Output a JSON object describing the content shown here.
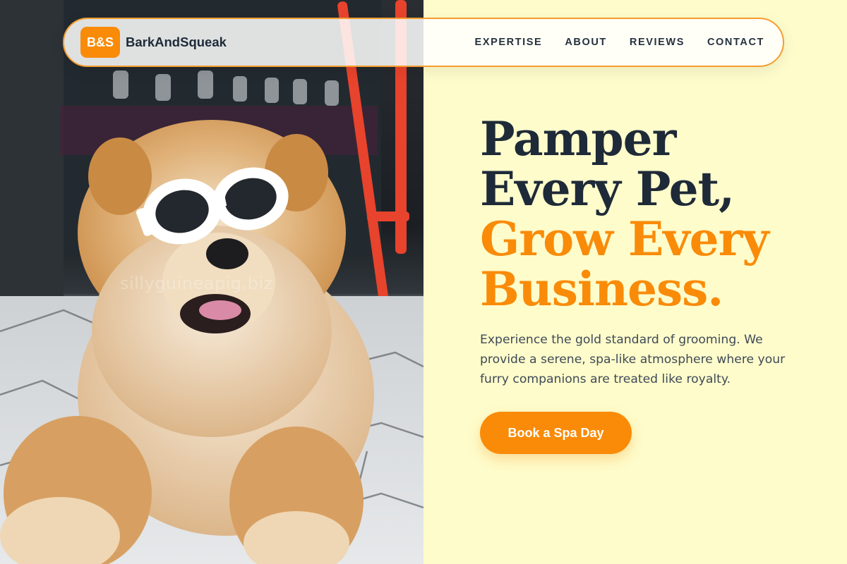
{
  "brand": {
    "logo_text": "B&S",
    "name": "BarkAndSqueak"
  },
  "nav": {
    "items": [
      {
        "label": "EXPERTISE"
      },
      {
        "label": "ABOUT"
      },
      {
        "label": "REVIEWS"
      },
      {
        "label": "CONTACT"
      }
    ]
  },
  "hero": {
    "headline_line1": "Pamper",
    "headline_line2": "Every Pet,",
    "headline_line3": "Grow Every",
    "headline_line4": "Business.",
    "description": "Experience the gold standard of grooming. We provide a serene, spa-like atmosphere where your furry companions are treated like royalty.",
    "cta_label": "Book a Spa Day",
    "image_watermark": "sillyguineapig.biz"
  },
  "colors": {
    "accent": "#f98b09",
    "background": "#fefccb",
    "heading": "#1e2a38",
    "body_text": "#3f4a57"
  }
}
